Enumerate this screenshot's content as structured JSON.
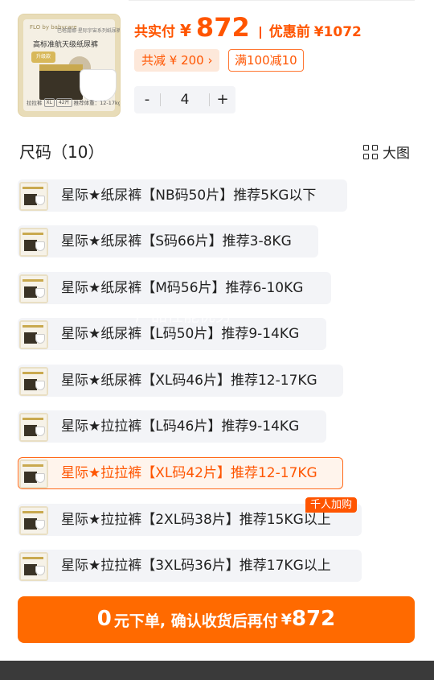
{
  "product_thumb": {
    "brand": "FLO by babycare",
    "tagline": "巴塔露娜·星际宇宙系列纸尿裤",
    "title": "高标准航天级纸尿裤",
    "badge": "升级款",
    "footer_type": "拉拉裤",
    "footer_size": "XL",
    "footer_count": "42片",
    "footer_weight": "推荐体重：12-17kg"
  },
  "price": {
    "label": "共实付",
    "currency": "¥",
    "value": "872",
    "original_label": "优惠前",
    "original": "¥1072"
  },
  "discount": {
    "total_text": "共减 ¥ 200 ›",
    "coupon_text": "满100减10"
  },
  "quantity": {
    "minus": "-",
    "value": "4",
    "plus": "+"
  },
  "size_section": {
    "title": "尺码（10）",
    "big_view_label": "大图"
  },
  "options": [
    {
      "label": "星际★纸尿裤【NB码50片】推荐5KG以下",
      "selected": false
    },
    {
      "label": "星际★纸尿裤【S码66片】推荐3-8KG",
      "selected": false
    },
    {
      "label": "星际★纸尿裤【M码56片】推荐6-10KG",
      "selected": false
    },
    {
      "label": "星际★纸尿裤【L码50片】推荐9-14KG",
      "selected": false
    },
    {
      "label": "星际★纸尿裤【XL码46片】推荐12-17KG",
      "selected": false
    },
    {
      "label": "星际★拉拉裤【L码46片】推荐9-14KG",
      "selected": false
    },
    {
      "label": "星际★拉拉裤【XL码42片】推荐12-17KG",
      "selected": true
    },
    {
      "label": "星际★拉拉裤【2XL码38片】推荐15KG以上",
      "selected": false
    },
    {
      "label": "星际★拉拉裤【3XL码36片】推荐17KG以上",
      "selected": false
    }
  ],
  "hot_badge": "千人加购",
  "watermark": "产品性能优势",
  "cta": {
    "zero": "0",
    "text": "元下单, 确认收货后再付",
    "currency": "¥",
    "price": "872"
  },
  "colors": {
    "accent": "#ff5500",
    "cta_bg": "#ff6a00",
    "option_bg": "#f3f4f7",
    "selected_bg": "#fff4ec"
  }
}
